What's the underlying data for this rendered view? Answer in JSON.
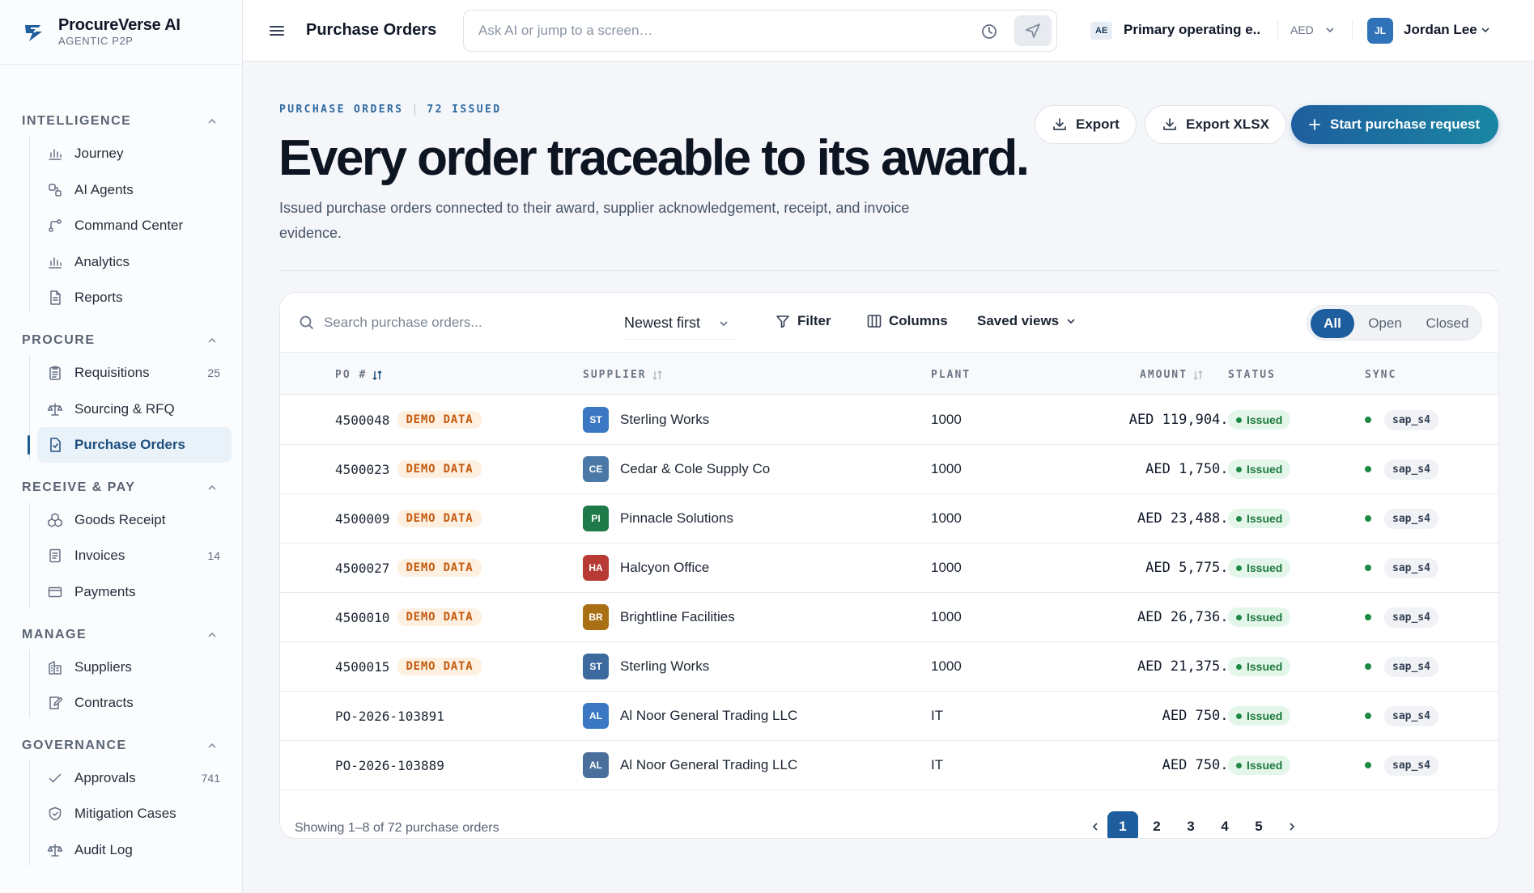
{
  "brand": {
    "name": "ProcureVerse AI",
    "subtitle": "AGENTIC P2P"
  },
  "sidebar": {
    "sections": [
      {
        "title": "INTELLIGENCE",
        "items": [
          {
            "label": "Journey",
            "icon": "chart-bar-icon"
          },
          {
            "label": "AI Agents",
            "icon": "agents-icon"
          },
          {
            "label": "Command Center",
            "icon": "command-icon"
          },
          {
            "label": "Analytics",
            "icon": "chart-bar-icon"
          },
          {
            "label": "Reports",
            "icon": "document-icon"
          }
        ]
      },
      {
        "title": "PROCURE",
        "items": [
          {
            "label": "Requisitions",
            "icon": "clipboard-icon",
            "count": "25"
          },
          {
            "label": "Sourcing & RFQ",
            "icon": "scale-icon"
          },
          {
            "label": "Purchase Orders",
            "icon": "purchase-order-icon",
            "active": true
          }
        ]
      },
      {
        "title": "RECEIVE & PAY",
        "items": [
          {
            "label": "Goods Receipt",
            "icon": "boxes-icon"
          },
          {
            "label": "Invoices",
            "icon": "invoice-icon",
            "count": "14"
          },
          {
            "label": "Payments",
            "icon": "card-icon"
          }
        ]
      },
      {
        "title": "MANAGE",
        "items": [
          {
            "label": "Suppliers",
            "icon": "building-icon"
          },
          {
            "label": "Contracts",
            "icon": "contract-icon"
          }
        ]
      },
      {
        "title": "GOVERNANCE",
        "items": [
          {
            "label": "Approvals",
            "icon": "check-icon",
            "count": "741"
          },
          {
            "label": "Mitigation Cases",
            "icon": "shield-icon"
          },
          {
            "label": "Audit Log",
            "icon": "scale-icon"
          }
        ]
      }
    ]
  },
  "topbar": {
    "title": "Purchase Orders",
    "search_placeholder": "Ask AI or jump to a screen…",
    "entity_code": "AE",
    "entity_name": "Primary operating e...",
    "currency": "AED",
    "user_initials": "JL",
    "user_name": "Jordan Lee"
  },
  "header": {
    "eyebrow": "PURCHASE ORDERS",
    "eyebrow_count": "72 ISSUED",
    "title": "Every order traceable to its award.",
    "description": "Issued purchase orders connected to their award, supplier acknowledgement, receipt, and invoice evidence.",
    "export_label": "Export",
    "export_xlsx_label": "Export XLSX",
    "primary_label": "Start purchase request"
  },
  "toolbar": {
    "search_placeholder": "Search purchase orders...",
    "sort_label": "Newest first",
    "filter_label": "Filter",
    "columns_label": "Columns",
    "saved_views_label": "Saved views",
    "segments": [
      "All",
      "Open",
      "Closed"
    ],
    "selected_segment": "All"
  },
  "table": {
    "columns": [
      "PO #",
      "SUPPLIER",
      "PLANT",
      "AMOUNT",
      "STATUS",
      "SYNC"
    ],
    "rows": [
      {
        "po": "4500048",
        "tag": "DEMO DATA",
        "supplier_initials": "ST",
        "supplier": "Sterling Works",
        "supplier_color": "#3b78c4",
        "plant": "1000",
        "amount": "AED 119,904.00",
        "status": "Issued",
        "sync": "sap_s4"
      },
      {
        "po": "4500023",
        "tag": "DEMO DATA",
        "supplier_initials": "CE",
        "supplier": "Cedar & Cole Supply Co",
        "supplier_color": "#4a79a8",
        "plant": "1000",
        "amount": "AED 1,750.00",
        "status": "Issued",
        "sync": "sap_s4"
      },
      {
        "po": "4500009",
        "tag": "DEMO DATA",
        "supplier_initials": "PI",
        "supplier": "Pinnacle Solutions",
        "supplier_color": "#1f7a4a",
        "plant": "1000",
        "amount": "AED 23,488.00",
        "status": "Issued",
        "sync": "sap_s4"
      },
      {
        "po": "4500027",
        "tag": "DEMO DATA",
        "supplier_initials": "HA",
        "supplier": "Halcyon Office",
        "supplier_color": "#b83a34",
        "plant": "1000",
        "amount": "AED 5,775.00",
        "status": "Issued",
        "sync": "sap_s4"
      },
      {
        "po": "4500010",
        "tag": "DEMO DATA",
        "supplier_initials": "BR",
        "supplier": "Brightline Facilities",
        "supplier_color": "#a87012",
        "plant": "1000",
        "amount": "AED 26,736.00",
        "status": "Issued",
        "sync": "sap_s4"
      },
      {
        "po": "4500015",
        "tag": "DEMO DATA",
        "supplier_initials": "ST",
        "supplier": "Sterling Works",
        "supplier_color": "#3d6a9e",
        "plant": "1000",
        "amount": "AED 21,375.00",
        "status": "Issued",
        "sync": "sap_s4"
      },
      {
        "po": "PO-2026-103891",
        "tag": "",
        "supplier_initials": "AL",
        "supplier": "Al Noor General Trading LLC",
        "supplier_color": "#3b78c4",
        "plant": "IT",
        "amount": "AED 750.00",
        "status": "Issued",
        "sync": "sap_s4"
      },
      {
        "po": "PO-2026-103889",
        "tag": "",
        "supplier_initials": "AL",
        "supplier": "Al Noor General Trading LLC",
        "supplier_color": "#4a6f9a",
        "plant": "IT",
        "amount": "AED 750.00",
        "status": "Issued",
        "sync": "sap_s4"
      }
    ]
  },
  "pagination": {
    "summary": "Showing 1–8 of 72 purchase orders",
    "pages": [
      "1",
      "2",
      "3",
      "4",
      "5"
    ],
    "current": "1"
  }
}
